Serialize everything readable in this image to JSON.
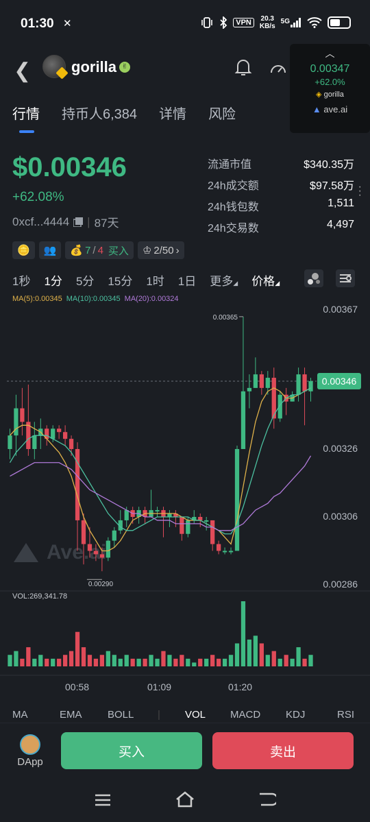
{
  "status": {
    "time": "01:30",
    "x_icon": "x-icon",
    "vpn": "VPN",
    "net_speed_top": "20.3",
    "net_speed_bottom": "KB/s",
    "signal": "5G"
  },
  "header": {
    "token_name": "gorilla",
    "verified_icon": "peace-hand-icon"
  },
  "popup": {
    "price": "0.00347",
    "change": "+62.0%",
    "token": "gorilla",
    "brand": "ave.ai"
  },
  "tabs": [
    {
      "label": "行情"
    },
    {
      "label": "持币人6,384"
    },
    {
      "label": "详情"
    },
    {
      "label": "风险"
    }
  ],
  "price": {
    "value": "$0.00346",
    "change": "+62.08%",
    "address": "0xcf...4444",
    "age": "87天"
  },
  "stats": [
    {
      "label": "流通市值",
      "value": "$340.35万"
    },
    {
      "label": "24h成交额",
      "value": "$97.58万"
    },
    {
      "label": "24h钱包数",
      "value": "1,511"
    },
    {
      "label": "24h交易数",
      "value": "4,497"
    }
  ],
  "badges": {
    "counter_a": "7",
    "counter_sep": "/",
    "counter_b": "4",
    "buy": "买入",
    "crown": "2/50"
  },
  "intervals": [
    {
      "label": "1秒"
    },
    {
      "label": "1分"
    },
    {
      "label": "5分"
    },
    {
      "label": "15分"
    },
    {
      "label": "1时"
    },
    {
      "label": "1日"
    },
    {
      "label": "更多"
    },
    {
      "label": "价格"
    }
  ],
  "ma": {
    "ma5": "MA(5):0.00345",
    "ma10": "MA(10):0.00345",
    "ma20": "MA(20):0.00324"
  },
  "vol_label": "VOL:269,341.78",
  "y_ticks": [
    "0.00367",
    "0.00326",
    "0.00306",
    "0.00286"
  ],
  "high_label": "0.00365",
  "low_label": "0.00290",
  "current_price_tag": "0.00346",
  "watermark": "Ave.ai",
  "time_ticks": [
    "00:58",
    "01:09",
    "01:20"
  ],
  "indicators": [
    {
      "label": "MA"
    },
    {
      "label": "EMA"
    },
    {
      "label": "BOLL"
    },
    {
      "label": "VOL"
    },
    {
      "label": "MACD"
    },
    {
      "label": "KDJ"
    },
    {
      "label": "RSI"
    }
  ],
  "bottom": {
    "dapp": "DApp",
    "buy": "买入",
    "sell": "卖出"
  },
  "colors": {
    "up": "#3fb983",
    "down": "#e04b59",
    "ma5": "#e0b24a",
    "ma10": "#4cc0a0",
    "ma20": "#b07ad9"
  },
  "chart_data": {
    "type": "candlestick",
    "y_range": [
      0.00286,
      0.00367
    ],
    "candles": [
      [
        0.00326,
        0.0033,
        0.00323,
        0.00332
      ],
      [
        0.0033,
        0.00338,
        0.00324,
        0.00342
      ],
      [
        0.00338,
        0.00334,
        0.0033,
        0.00344
      ],
      [
        0.00334,
        0.00326,
        0.00324,
        0.00345
      ],
      [
        0.00326,
        0.0033,
        0.00323,
        0.00334
      ],
      [
        0.0033,
        0.00332,
        0.00326,
        0.00335
      ],
      [
        0.00332,
        0.00329,
        0.00327,
        0.00333
      ],
      [
        0.00329,
        0.00332,
        0.00328,
        0.00333
      ],
      [
        0.00332,
        0.00331,
        0.00329,
        0.00333
      ],
      [
        0.00331,
        0.00329,
        0.00327,
        0.00333
      ],
      [
        0.00329,
        0.00326,
        0.00324,
        0.0033
      ],
      [
        0.00326,
        0.00305,
        0.00296,
        0.00328
      ],
      [
        0.00305,
        0.00298,
        0.00292,
        0.00307
      ],
      [
        0.00298,
        0.00296,
        0.00294,
        0.00303
      ],
      [
        0.00296,
        0.00295,
        0.00293,
        0.00298
      ],
      [
        0.00295,
        0.00294,
        0.0029,
        0.00297
      ],
      [
        0.00294,
        0.00299,
        0.00293,
        0.003
      ],
      [
        0.00299,
        0.00302,
        0.00297,
        0.00303
      ],
      [
        0.00302,
        0.00305,
        0.00301,
        0.00308
      ],
      [
        0.00305,
        0.00308,
        0.00303,
        0.00309
      ],
      [
        0.00308,
        0.00306,
        0.00304,
        0.00309
      ],
      [
        0.00306,
        0.00308,
        0.00304,
        0.00309
      ],
      [
        0.00308,
        0.00306,
        0.00304,
        0.00309
      ],
      [
        0.00306,
        0.00308,
        0.00306,
        0.00314
      ],
      [
        0.00308,
        0.00308,
        0.00306,
        0.00309
      ],
      [
        0.00308,
        0.00306,
        0.003,
        0.00309
      ],
      [
        0.00306,
        0.00307,
        0.00303,
        0.00308
      ],
      [
        0.00307,
        0.00306,
        0.00303,
        0.00308
      ],
      [
        0.00306,
        0.00301,
        0.00299,
        0.00306
      ],
      [
        0.00301,
        0.00305,
        0.003,
        0.00306
      ],
      [
        0.00305,
        0.00306,
        0.00304,
        0.00308
      ],
      [
        0.00306,
        0.00305,
        0.00303,
        0.00307
      ],
      [
        0.00305,
        0.00305,
        0.00302,
        0.00306
      ],
      [
        0.00305,
        0.00298,
        0.00296,
        0.00305
      ],
      [
        0.00298,
        0.00296,
        0.00295,
        0.00299
      ],
      [
        0.00296,
        0.00296,
        0.00295,
        0.00297
      ],
      [
        0.00296,
        0.00296,
        0.00295,
        0.00297
      ],
      [
        0.00296,
        0.00326,
        0.00296,
        0.00327
      ],
      [
        0.00326,
        0.00343,
        0.00326,
        0.00365
      ],
      [
        0.00343,
        0.00344,
        0.00338,
        0.00348
      ],
      [
        0.00344,
        0.00348,
        0.00344,
        0.00353
      ],
      [
        0.00348,
        0.00344,
        0.00342,
        0.00349
      ],
      [
        0.00344,
        0.00347,
        0.00342,
        0.00349
      ],
      [
        0.00347,
        0.00335,
        0.00332,
        0.0035
      ],
      [
        0.00335,
        0.00342,
        0.00334,
        0.00343
      ],
      [
        0.00342,
        0.0034,
        0.00336,
        0.00344
      ],
      [
        0.0034,
        0.00342,
        0.0034,
        0.00343
      ],
      [
        0.00342,
        0.00348,
        0.0034,
        0.0035
      ],
      [
        0.00348,
        0.00343,
        0.00333,
        0.0035
      ],
      [
        0.00343,
        0.00346,
        0.0034,
        0.00347
      ]
    ],
    "ma5": [
      0.0033,
      0.00332,
      0.00333,
      0.00333,
      0.00332,
      0.00331,
      0.00329,
      0.00327,
      0.00325,
      0.00322,
      0.00318,
      0.00312,
      0.00306,
      0.00302,
      0.00299,
      0.00296,
      0.00296,
      0.00297,
      0.00299,
      0.00302,
      0.00305,
      0.00306,
      0.00307,
      0.00307,
      0.00307,
      0.00307,
      0.00307,
      0.00307,
      0.00306,
      0.00305,
      0.00305,
      0.00305,
      0.00304,
      0.00303,
      0.00302,
      0.003,
      0.00298,
      0.00305,
      0.00315,
      0.00325,
      0.00334,
      0.0034,
      0.00343,
      0.00344,
      0.00343,
      0.00341,
      0.00341,
      0.00342,
      0.00343,
      0.00344
    ],
    "ma10": [
      0.00322,
      0.00325,
      0.00327,
      0.00329,
      0.0033,
      0.0033,
      0.0033,
      0.00329,
      0.00328,
      0.00327,
      0.00325,
      0.00322,
      0.00319,
      0.00316,
      0.00313,
      0.0031,
      0.00307,
      0.00305,
      0.00303,
      0.00302,
      0.00302,
      0.00303,
      0.00304,
      0.00305,
      0.00306,
      0.00306,
      0.00306,
      0.00306,
      0.00306,
      0.00306,
      0.00305,
      0.00305,
      0.00304,
      0.00303,
      0.00302,
      0.00301,
      0.00301,
      0.00304,
      0.00309,
      0.00315,
      0.00321,
      0.00327,
      0.00332,
      0.00336,
      0.00339,
      0.00341,
      0.00342,
      0.00342,
      0.00343,
      0.00344
    ],
    "ma20": [
      0.00318,
      0.00319,
      0.0032,
      0.00321,
      0.00322,
      0.00322,
      0.00322,
      0.00322,
      0.00322,
      0.00321,
      0.0032,
      0.00318,
      0.00316,
      0.00314,
      0.00313,
      0.00312,
      0.00311,
      0.0031,
      0.00309,
      0.00308,
      0.00307,
      0.00307,
      0.00306,
      0.00306,
      0.00305,
      0.00305,
      0.00305,
      0.00304,
      0.00304,
      0.00304,
      0.00304,
      0.00304,
      0.00303,
      0.00303,
      0.00302,
      0.00302,
      0.00302,
      0.00303,
      0.00304,
      0.00306,
      0.00308,
      0.00309,
      0.0031,
      0.00312,
      0.00313,
      0.00315,
      0.00317,
      0.00319,
      0.00321,
      0.00324
    ],
    "volume": [
      3,
      4,
      2,
      5,
      2,
      3,
      2,
      2,
      2,
      3,
      4,
      9,
      5,
      3,
      2,
      3,
      4,
      3,
      2,
      3,
      2,
      2,
      2,
      3,
      2,
      4,
      3,
      2,
      3,
      2,
      1,
      2,
      2,
      3,
      2,
      2,
      3,
      6,
      17,
      7,
      8,
      6,
      3,
      4,
      2,
      3,
      2,
      5,
      2,
      3
    ]
  }
}
